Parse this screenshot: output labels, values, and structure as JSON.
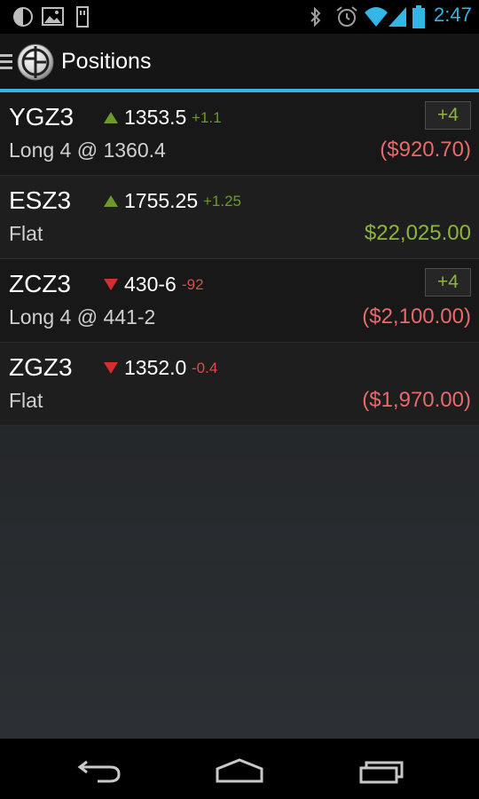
{
  "status_bar": {
    "time": "2:47",
    "icons": [
      "notification-circle-icon",
      "gallery-icon",
      "sd-card-icon",
      "bluetooth-icon",
      "alarm-icon",
      "wifi-icon",
      "cell-signal-icon",
      "battery-icon"
    ]
  },
  "header": {
    "title": "Positions",
    "icons": [
      "menu-icon",
      "app-logo-icon"
    ]
  },
  "positions": [
    {
      "symbol": "YGZ3",
      "direction": "up",
      "price": "1353.5",
      "change": "+1.1",
      "status": "Long 4 @ 1360.4",
      "pnl": "($920.70)",
      "pnl_sign": "negative",
      "badge": "+4"
    },
    {
      "symbol": "ESZ3",
      "direction": "up",
      "price": "1755.25",
      "change": "+1.25",
      "status": "Flat",
      "pnl": "$22,025.00",
      "pnl_sign": "positive",
      "badge": ""
    },
    {
      "symbol": "ZCZ3",
      "direction": "down",
      "price": "430-6",
      "change": "-92",
      "status": "Long 4 @ 441-2",
      "pnl": "($2,100.00)",
      "pnl_sign": "negative",
      "badge": "+4"
    },
    {
      "symbol": "ZGZ3",
      "direction": "down",
      "price": "1352.0",
      "change": "-0.4",
      "status": "Flat",
      "pnl": "($1,970.00)",
      "pnl_sign": "negative",
      "badge": ""
    }
  ],
  "nav_bar": {
    "icons": [
      "back-icon",
      "home-icon",
      "recent-apps-icon"
    ]
  },
  "colors": {
    "accent": "#33b5e5",
    "up": "#6c9a2a",
    "down": "#e04a4a",
    "pnl_positive": "#8db43c",
    "pnl_negative": "#e86a6a"
  }
}
